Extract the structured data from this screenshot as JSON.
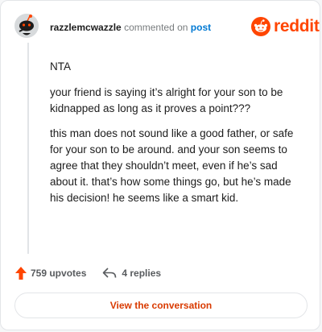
{
  "comment": {
    "username": "razzlemcwazzle",
    "action_text": "commented on",
    "post_link_label": "post",
    "brand_wordmark": "reddit",
    "paragraphs": [
      "NTA",
      "your friend is saying it’s alright for your son to be kidnapped as long as it proves a point???",
      "this man does not sound like a good father, or safe for your son to be around. and your son seems to agree that they shouldn’t meet, even if he’s sad about it. that’s how some things go, but he’s made his decision! he seems like a smart kid."
    ]
  },
  "footer": {
    "upvotes_label": "759 upvotes",
    "replies_label": "4 replies"
  },
  "actions": {
    "view_conversation_label": "View the conversation"
  },
  "icons": {
    "avatar": "snoo-avatar-icon",
    "brand": "reddit-logo-icon",
    "upvote": "upvote-arrow-icon",
    "reply": "reply-arrow-icon"
  },
  "colors": {
    "brand": "#ff4500",
    "link": "#0079d3",
    "button_text": "#d93a00",
    "text": "#1c1c1c",
    "muted": "#787c7e"
  }
}
